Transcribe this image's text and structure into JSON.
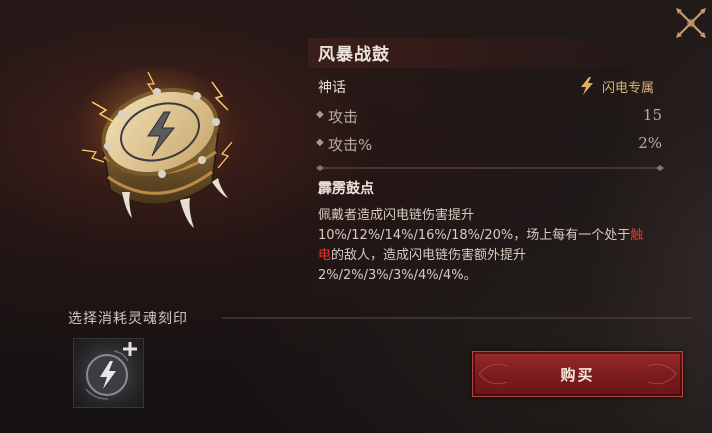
{
  "item": {
    "name": "风暴战鼓",
    "rarity": "神话",
    "tag": "闪电专属",
    "stats": [
      {
        "name": "攻击",
        "value": "15"
      },
      {
        "name": "攻击%",
        "value": "2%"
      }
    ]
  },
  "skill": {
    "name": "霹雳鼓点",
    "desc_line1": "佩戴者造成闪电链伤害提升",
    "desc_line2a": "10%/12%/14%/16%/18%/20%，场上每有一个处于",
    "desc_hl1": "触",
    "desc_hl2": "电",
    "desc_line3b": "的敌人，造成闪电链伤害额外提升",
    "desc_line4": "2%/2%/3%/3%/4%/4%。"
  },
  "soul": {
    "label": "选择消耗灵魂刻印"
  },
  "actions": {
    "buy_label": "购买"
  },
  "colors": {
    "highlight": "#e0392f",
    "tag_gold": "#d9b274",
    "button_red": "#8a2224"
  },
  "icons": {
    "close": "close-icon",
    "lightning": "lightning-icon",
    "add": "plus-icon"
  }
}
